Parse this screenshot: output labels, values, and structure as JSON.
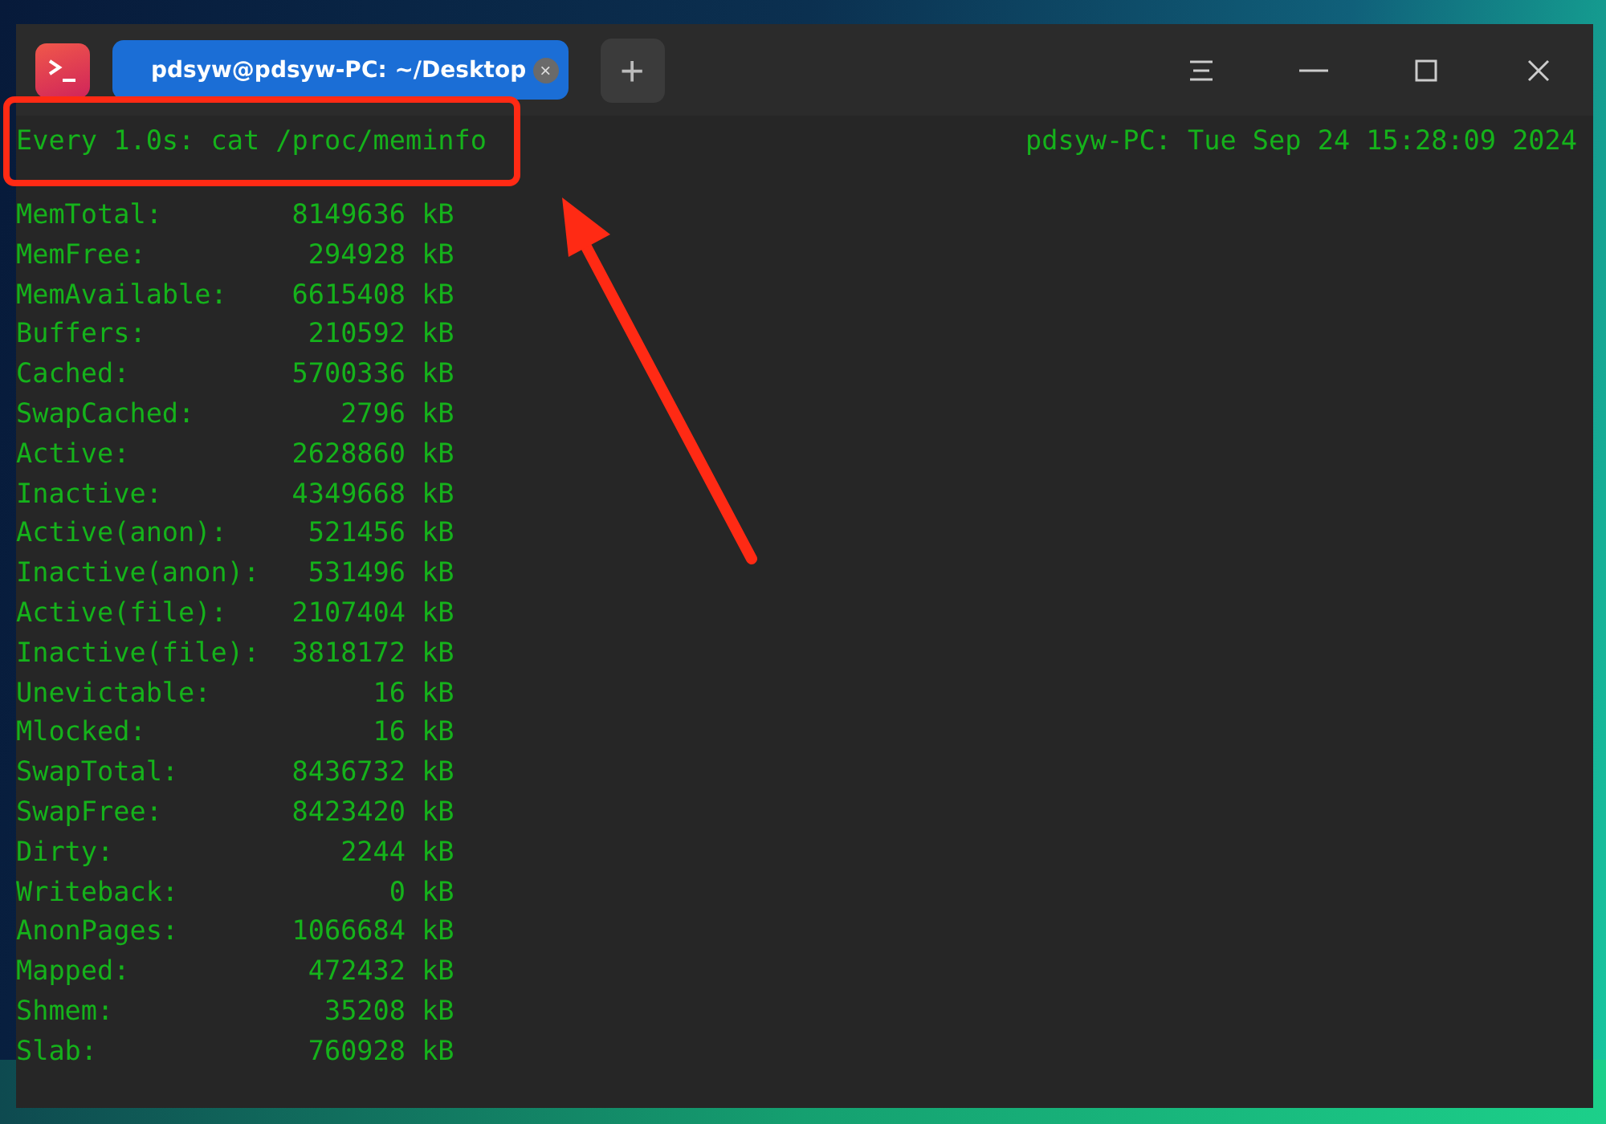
{
  "window": {
    "title_tab": {
      "label": "pdsyw@pdsyw-PC: ~/Desktop",
      "selected": true,
      "close": "×"
    },
    "new_tab": "+"
  },
  "terminal": {
    "header_left": "Every 1.0s: cat /proc/meminfo",
    "header_right": "pdsyw-PC: Tue Sep 24 15:28:09 2024",
    "lines": [
      "MemTotal:        8149636 kB",
      "MemFree:          294928 kB",
      "MemAvailable:    6615408 kB",
      "Buffers:          210592 kB",
      "Cached:          5700336 kB",
      "SwapCached:         2796 kB",
      "Active:          2628860 kB",
      "Inactive:        4349668 kB",
      "Active(anon):     521456 kB",
      "Inactive(anon):   531496 kB",
      "Active(file):    2107404 kB",
      "Inactive(file):  3818172 kB",
      "Unevictable:          16 kB",
      "Mlocked:              16 kB",
      "SwapTotal:       8436732 kB",
      "SwapFree:        8423420 kB",
      "Dirty:              2244 kB",
      "Writeback:             0 kB",
      "AnonPages:       1066684 kB",
      "Mapped:           472432 kB",
      "Shmem:             35208 kB",
      "Slab:             760928 kB"
    ]
  }
}
